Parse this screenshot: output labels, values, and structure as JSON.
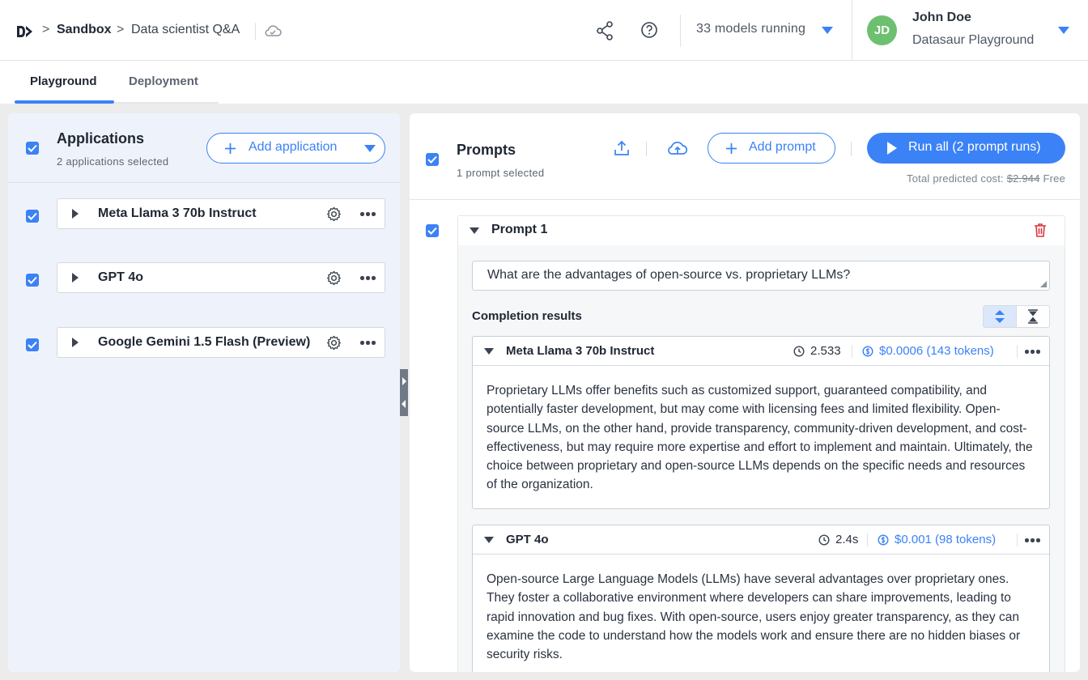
{
  "breadcrumb": {
    "workspace": "Sandbox",
    "project": "Data scientist Q&A"
  },
  "header": {
    "models_running": "33 models running"
  },
  "user": {
    "initials": "JD",
    "name": "John Doe",
    "org": "Datasaur Playground"
  },
  "tabs": [
    {
      "label": "Playground",
      "active": true
    },
    {
      "label": "Deployment",
      "active": false
    }
  ],
  "applications": {
    "title": "Applications",
    "subtitle": "2 applications selected",
    "add_label": "Add application",
    "items": [
      {
        "name": "Meta Llama 3 70b Instruct",
        "checked": true
      },
      {
        "name": "GPT 4o",
        "checked": true
      },
      {
        "name": "Google Gemini 1.5 Flash (Preview)",
        "checked": true
      }
    ]
  },
  "prompts": {
    "title": "Prompts",
    "subtitle": "1 prompt selected",
    "add_label": "Add prompt",
    "run_label": "Run all (2 prompt runs)",
    "cost_label": "Total predicted cost:",
    "cost_old": "$2.944",
    "cost_new": "Free",
    "prompt": {
      "title": "Prompt 1",
      "text": "What are the advantages of open-source vs. proprietary LLMs?",
      "completion_title": "Completion results",
      "results": [
        {
          "model": "Meta Llama 3 70b Instruct",
          "time": "2.533",
          "cost": "$0.0006 (143 tokens)",
          "text": "Proprietary LLMs offer benefits such as customized support, guaranteed compatibility, and potentially faster development, but may come with licensing fees and limited flexibility. Open-source LLMs, on the other hand, provide transparency, community-driven development, and cost-effectiveness, but may require more expertise and effort to implement and maintain. Ultimately, the choice between proprietary and open-source LLMs depends on the specific needs and resources of the organization."
        },
        {
          "model": "GPT 4o",
          "time": "2.4s",
          "cost": "$0.001 (98 tokens)",
          "text": "Open-source Large Language Models (LLMs) have several advantages over proprietary ones. They foster a collaborative environment where developers can share improvements, leading to rapid innovation and bug fixes. With open-source, users enjoy greater transparency, as they can examine the code to understand how the models work and ensure there are no hidden biases or security risks."
        }
      ]
    }
  },
  "colors": {
    "accent": "#3b82f6",
    "avatar": "#6dc06f",
    "danger": "#d9363e",
    "left_panel_bg": "#eef3fb"
  },
  "icons": [
    "logo-icon",
    "cloud-sync-icon",
    "share-icon",
    "help-icon",
    "gear-icon",
    "upload-icon",
    "cloud-upload-icon",
    "plus-icon",
    "play-icon",
    "trash-icon",
    "clock-icon",
    "coin-icon",
    "expand-icon",
    "collapse-icon"
  ]
}
